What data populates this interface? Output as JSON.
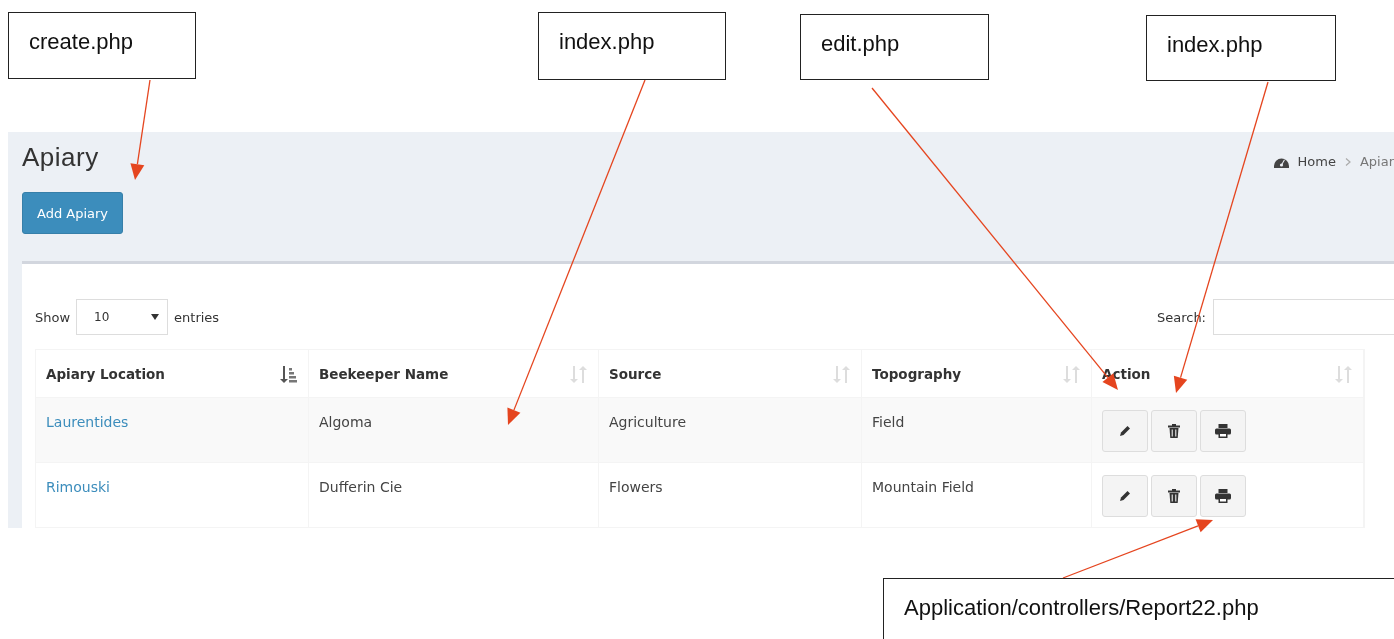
{
  "callouts": [
    {
      "text": "create.php"
    },
    {
      "text": "index.php"
    },
    {
      "text": "edit.php"
    },
    {
      "text": "index.php"
    },
    {
      "text": "Application/controllers/Report22.php"
    }
  ],
  "page": {
    "title": "Apiary",
    "breadcrumb": [
      {
        "text": "Home",
        "kind": "home"
      },
      {
        "text": "Apiar",
        "kind": "current"
      }
    ],
    "add_button": "Add Apiary"
  },
  "table_controls": {
    "show_label": "Show",
    "page_size": "10",
    "entries_label": "entries",
    "search_label": "Search:"
  },
  "table": {
    "columns": [
      {
        "label": "Apiary Location",
        "sorted": true
      },
      {
        "label": "Beekeeper Name",
        "sorted": false
      },
      {
        "label": "Source",
        "sorted": false
      },
      {
        "label": "Topography",
        "sorted": false
      },
      {
        "label": "Action",
        "sorted": false
      }
    ],
    "rows": [
      {
        "cells": [
          "Laurentides",
          "Algoma",
          "Agriculture",
          "Field"
        ],
        "actions": [
          {
            "kind": "edit"
          },
          {
            "kind": "delete"
          },
          {
            "kind": "print"
          }
        ]
      },
      {
        "cells": [
          "Rimouski",
          "Dufferin Cie",
          "Flowers",
          "Mountain Field"
        ],
        "actions": [
          {
            "kind": "edit"
          },
          {
            "kind": "delete"
          },
          {
            "kind": "print"
          }
        ]
      }
    ]
  }
}
